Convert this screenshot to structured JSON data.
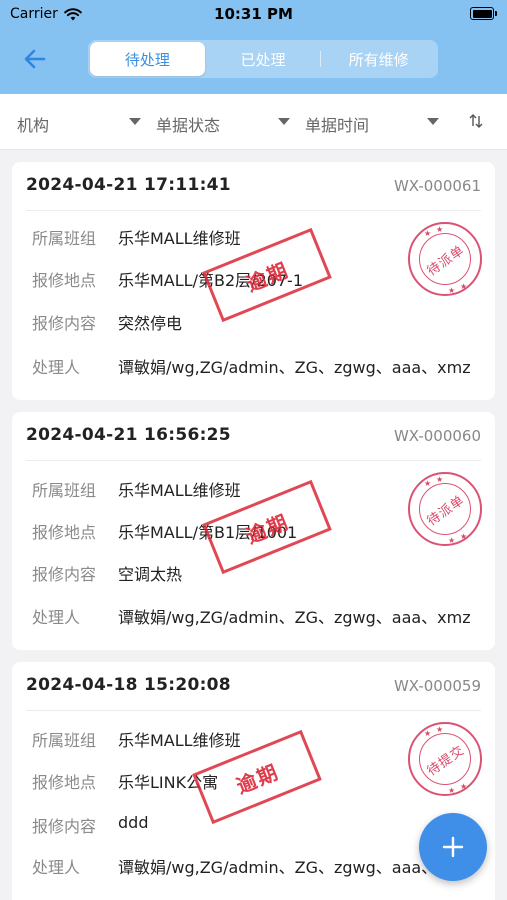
{
  "status": {
    "carrier": "Carrier",
    "time": "10:31 PM"
  },
  "tabs": [
    {
      "label": "待处理",
      "active": true
    },
    {
      "label": "已处理",
      "active": false
    },
    {
      "label": "所有维修",
      "active": false
    }
  ],
  "filters": {
    "org": "机构",
    "status": "单据状态",
    "time": "单据时间"
  },
  "labels": {
    "group": "所属班组",
    "location": "报修地点",
    "content": "报修内容",
    "handler": "处理人"
  },
  "cards": [
    {
      "datetime": "2024-04-21 17:11:41",
      "code": "WX-000061",
      "group": "乐华MALL维修班",
      "location": "乐华MALL/第B2层/207-1",
      "content": "突然停电",
      "handler": "谭敏娟/wg,ZG/admin、ZG、zgwg、aaa、xmz",
      "overdue_stamp": "逾期",
      "status_stamp": "待派单"
    },
    {
      "datetime": "2024-04-21 16:56:25",
      "code": "WX-000060",
      "group": "乐华MALL维修班",
      "location": "乐华MALL/第B1层/1001",
      "content": "空调太热",
      "handler": "谭敏娟/wg,ZG/admin、ZG、zgwg、aaa、xmz",
      "overdue_stamp": "逾期",
      "status_stamp": "待派单"
    },
    {
      "datetime": "2024-04-18 15:20:08",
      "code": "WX-000059",
      "group": "乐华MALL维修班",
      "location": "乐华LINK公寓",
      "content": "ddd",
      "handler": "谭敏娟/wg,ZG/admin、ZG、zgwg、aaa、xmz",
      "overdue_stamp": "逾期",
      "status_stamp": "待提交"
    }
  ],
  "colors": {
    "header": "#86c2f1",
    "accent": "#3a8fe0",
    "stamp_red": "#dc2837"
  },
  "icons": [
    "wifi-icon",
    "battery-icon",
    "back-arrow-icon",
    "caret-down-icon",
    "sort-icon",
    "add-icon"
  ]
}
